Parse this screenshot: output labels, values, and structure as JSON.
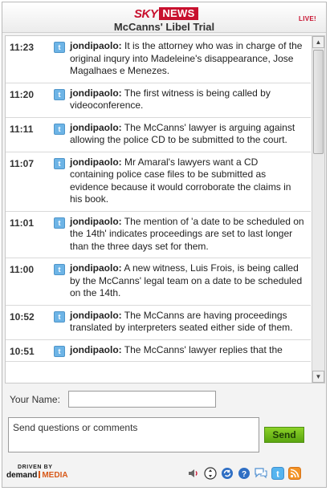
{
  "header": {
    "logo_sky": "SKY",
    "logo_news": "NEWS",
    "title": "McCanns' Libel Trial",
    "live_badge": "LIVE!"
  },
  "feed": {
    "entries": [
      {
        "time": "11:23",
        "author": "jondipaolo:",
        "text": " It is the attorney who was in charge of the original inqury into Madeleine's disappearance, Jose Magalhaes e Menezes."
      },
      {
        "time": "11:20",
        "author": "jondipaolo:",
        "text": " The first witness is being called by videoconference."
      },
      {
        "time": "11:11",
        "author": "jondipaolo:",
        "text": " The McCanns' lawyer is arguing against allowing the police CD to be submitted to the court."
      },
      {
        "time": "11:07",
        "author": "jondipaolo:",
        "text": " Mr Amaral's lawyers want a CD containing police case files to be submitted as evidence because it would corroborate the claims in his book."
      },
      {
        "time": "11:01",
        "author": "jondipaolo:",
        "text": " The mention of 'a date to be scheduled on the 14th' indicates proceedings are set to last longer than the three days set for them."
      },
      {
        "time": "11:00",
        "author": "jondipaolo:",
        "text": " A new witness, Luis Frois, is being called by the McCanns' legal team on a date to be scheduled on the 14th."
      },
      {
        "time": "10:52",
        "author": "jondipaolo:",
        "text": " The McCanns are having proceedings translated by interpreters seated either side of them."
      },
      {
        "time": "10:51",
        "author": "jondipaolo:",
        "text": " The McCanns' lawyer replies that the"
      }
    ]
  },
  "form": {
    "name_label": "Your Name:",
    "name_value": "",
    "comment_placeholder": "Send questions or comments",
    "send_label": "Send"
  },
  "footer": {
    "driven_by": "DRIVEN BY",
    "brand_demand": "demand",
    "brand_media": "MEDIA",
    "icons": [
      "speaker-icon",
      "navigate-icon",
      "refresh-icon",
      "help-icon",
      "chat-icon",
      "twitter-icon",
      "rss-icon"
    ]
  },
  "colors": {
    "brand_red": "#c8102e",
    "send_green": "#6cb81c",
    "twitter_blue": "#6db4e6",
    "demand_media_orange": "#d85a1a"
  }
}
